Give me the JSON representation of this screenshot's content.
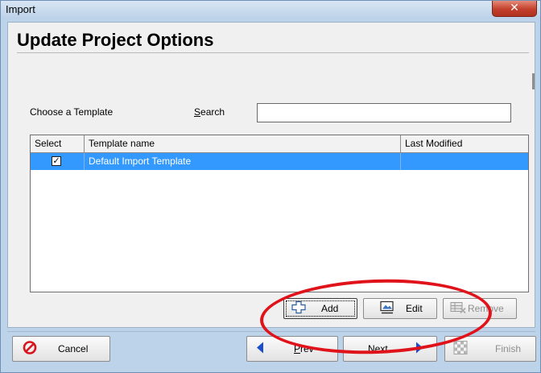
{
  "window": {
    "title": "Import",
    "close_glyph": "✕"
  },
  "page": {
    "title": "Update Project Options"
  },
  "template_picker": {
    "choose_label": "Choose a Template",
    "search_label_underlined": "S",
    "search_label_rest": "earch",
    "search_value": "",
    "search_placeholder": ""
  },
  "grid": {
    "columns": [
      "Select",
      "Template name",
      "Last Modified"
    ],
    "rows": [
      {
        "selected": true,
        "checked": true,
        "check_glyph": "✓",
        "template_name": "Default Import Template",
        "last_modified": ""
      }
    ]
  },
  "template_actions": {
    "add_label": "Add",
    "edit_label": "Edit",
    "remove_label": "Remove"
  },
  "footer": {
    "cancel_label": "Cancel",
    "prev_label_underlined": "P",
    "prev_label_rest": "rev",
    "next_label_underlined": "N",
    "next_label_rest": "ext",
    "finish_label": "Finish"
  },
  "icons": {
    "add": "add-cross-icon",
    "edit": "edit-image-icon",
    "remove": "remove-grid-icon",
    "cancel": "cancel-circle-icon",
    "prev": "arrow-left-icon",
    "next": "arrow-right-icon",
    "finish": "finish-checkered-icon"
  },
  "colors": {
    "selection": "#3399ff",
    "annotation": "#e0121a",
    "arrow": "#1a4fc9",
    "cancel_icon": "#d8141c",
    "close_button": "#c2402b"
  }
}
